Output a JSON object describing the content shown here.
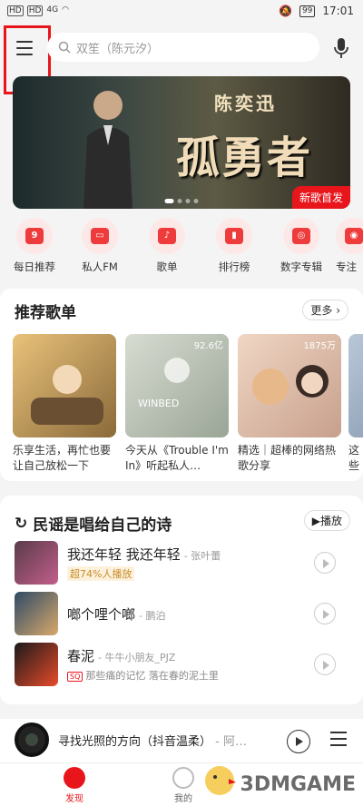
{
  "status_bar": {
    "time": "17:01",
    "battery": "99",
    "network": "4G"
  },
  "search": {
    "placeholder": "双笙（陈元汐）"
  },
  "banner": {
    "artist": "陈奕迅",
    "song": "孤勇者",
    "tag": "新歌首发"
  },
  "quick_entries": [
    {
      "label": "每日推荐",
      "icon": "calendar-icon",
      "glyph": "9"
    },
    {
      "label": "私人FM",
      "icon": "radio-icon",
      "glyph": "▭"
    },
    {
      "label": "歌单",
      "icon": "playlist-icon",
      "glyph": "♪"
    },
    {
      "label": "排行榜",
      "icon": "chart-icon",
      "glyph": "▮"
    },
    {
      "label": "数字专辑",
      "icon": "album-icon",
      "glyph": "◎"
    },
    {
      "label": "专注",
      "icon": "focus-icon",
      "glyph": "◉"
    }
  ],
  "recommended": {
    "title": "推荐歌单",
    "more_label": "更多",
    "playlists": [
      {
        "name": "乐享生活，再忙也要让自己放松一下",
        "count": ""
      },
      {
        "name": "今天从《Trouble I'm In》听起私人…",
        "count": "92.6亿"
      },
      {
        "name": "精选｜超棒的网络热歌分享",
        "count": "1875万"
      },
      {
        "name": "这些循环",
        "count": ""
      }
    ]
  },
  "section": {
    "title": "民谣是唱给自己的诗",
    "play_label": "播放",
    "songs": [
      {
        "title": "我还年轻 我还年轻",
        "artist": "- 张叶蕾",
        "sub": "超74%人播放",
        "sub_type": "gold",
        "sq": ""
      },
      {
        "title": "啷个哩个啷",
        "artist": "- 鹏泊",
        "sub": "",
        "sub_type": "",
        "sq": ""
      },
      {
        "title": "春泥",
        "artist": "- 牛牛小朋友_PJZ",
        "sub": "那些痛的记忆 落在春的泥土里",
        "sub_type": "gray",
        "sq": "SQ"
      }
    ]
  },
  "mini_player": {
    "title": "寻找光照的方向（抖音温柔）",
    "artist": "- 阿…"
  },
  "tabs": [
    {
      "label": "发现"
    },
    {
      "label": "我的"
    }
  ],
  "watermark": "3DMGAME",
  "colors": {
    "accent": "#e8151b",
    "icon_bg": "#fde8e8"
  }
}
